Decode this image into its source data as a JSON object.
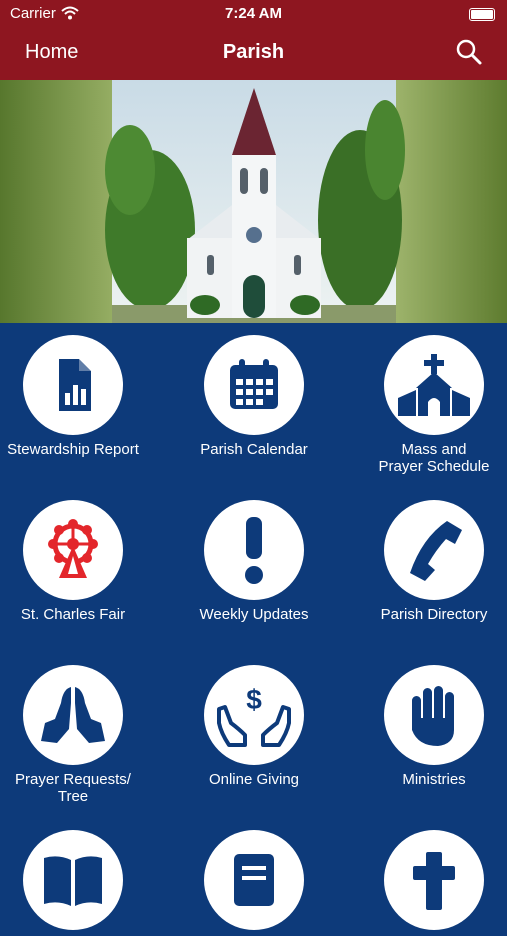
{
  "status_bar": {
    "carrier": "Carrier",
    "time": "7:24 AM"
  },
  "navbar": {
    "back_label": "Home",
    "title": "Parish"
  },
  "colors": {
    "navbar": "#8e1620",
    "background": "#0d3a7a",
    "icon": "#0d3a7a",
    "fair_icon": "#e3262b"
  },
  "tiles": [
    {
      "label": "Stewardship Report",
      "icon": "report-icon"
    },
    {
      "label": "Parish Calendar",
      "icon": "calendar-icon"
    },
    {
      "label": "Mass and\nPrayer Schedule",
      "icon": "church-icon"
    },
    {
      "label": "St. Charles Fair",
      "icon": "ferris-wheel-icon"
    },
    {
      "label": "Weekly Updates",
      "icon": "exclamation-icon"
    },
    {
      "label": "Parish Directory",
      "icon": "phone-icon"
    },
    {
      "label": "Prayer Requests/\nTree",
      "icon": "praying-hands-icon"
    },
    {
      "label": "Online Giving",
      "icon": "giving-icon"
    },
    {
      "label": "Ministries",
      "icon": "hand-icon"
    },
    {
      "label": "",
      "icon": "book-icon"
    },
    {
      "label": "",
      "icon": "bulletin-icon"
    },
    {
      "label": "",
      "icon": "cross-icon"
    }
  ]
}
